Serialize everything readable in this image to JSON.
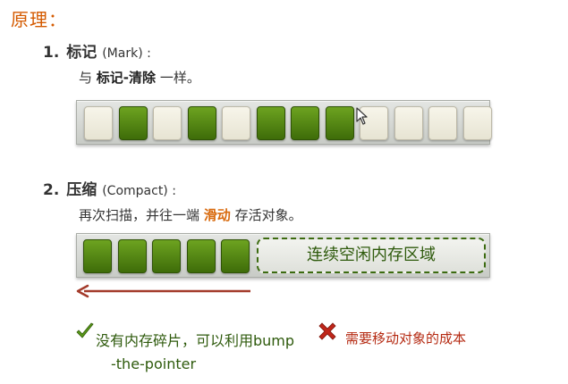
{
  "page_title": "原理：",
  "step1": {
    "number": "1.",
    "title": "标记",
    "subtitle": "(Mark) :",
    "desc_prefix": "与",
    "desc_bold": "标记-清除",
    "desc_suffix": "一样。",
    "cells": [
      "free",
      "used",
      "free",
      "used",
      "free",
      "used",
      "used",
      "used",
      "free",
      "free",
      "free",
      "free"
    ]
  },
  "step2": {
    "number": "2.",
    "title": "压缩",
    "subtitle": "(Compact) :",
    "desc_prefix": "再次扫描，并往一端",
    "desc_highlight": "滑动",
    "desc_suffix": "存活对象。",
    "used_count": 5,
    "free_zone_label": "连续空闲内存区域"
  },
  "pros": {
    "line1": "没有内存碎片，可以利用bump",
    "line2": "-the-pointer"
  },
  "cons": {
    "text": "需要移动对象的成本"
  },
  "colors": {
    "title": "#d45a00",
    "used_cell": "#4f8412",
    "free_cell": "#efede0",
    "arrow": "#a33a2a",
    "check": "#5a9a1a",
    "cross": "#c0261a"
  }
}
